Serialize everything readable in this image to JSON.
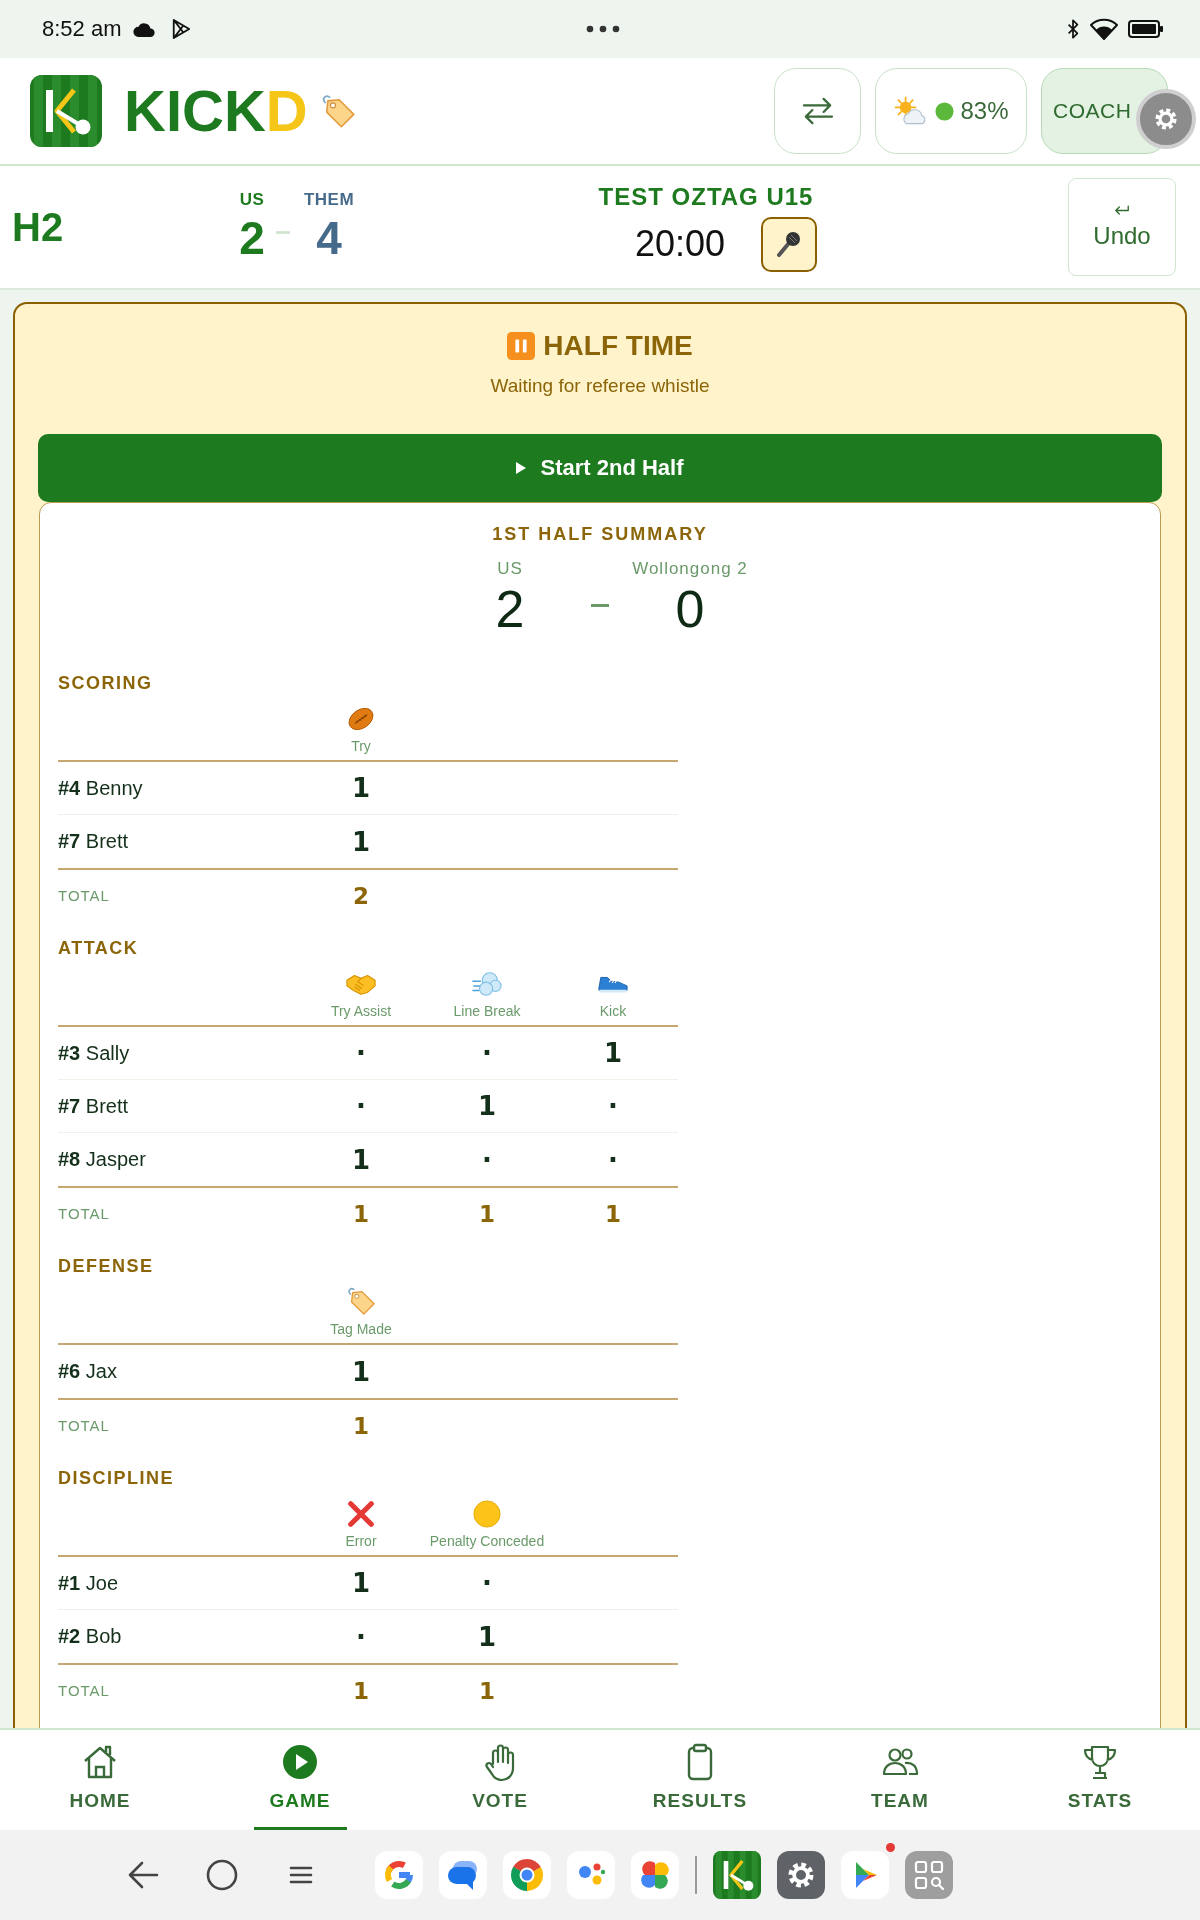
{
  "status_bar": {
    "time": "8:52 am"
  },
  "header": {
    "app_name": "KICKD",
    "weather": {
      "reading": "83%"
    },
    "coach_button": "COACH"
  },
  "score_bar": {
    "period": "H2",
    "us_label": "US",
    "them_label": "THEM",
    "us_score": "2",
    "them_score": "4",
    "match_title": "TEST OZTAG U15",
    "clock": "20:00",
    "undo_label": "Undo"
  },
  "half_time": {
    "title": "HALF TIME",
    "subtitle": "Waiting for referee whistle",
    "start_button": "Start 2nd Half"
  },
  "summary": {
    "title": "1ST HALF SUMMARY",
    "us_label": "US",
    "them_label": "Wollongong 2",
    "us_score": "2",
    "them_score": "0",
    "sections": [
      {
        "title": "SCORING",
        "columns": [
          {
            "kind": "try",
            "label": "Try"
          }
        ],
        "rows": [
          {
            "player": "**#4** Benny",
            "values": [
              "1"
            ]
          },
          {
            "player": "**#7** Brett",
            "values": [
              "1"
            ]
          }
        ],
        "total": {
          "label": "TOTAL",
          "values": [
            "2"
          ]
        }
      },
      {
        "title": "ATTACK",
        "columns": [
          {
            "kind": "assist",
            "label": "Try Assist"
          },
          {
            "kind": "break",
            "label": "Line Break"
          },
          {
            "kind": "kick",
            "label": "Kick"
          }
        ],
        "rows": [
          {
            "player": "**#3** Sally",
            "values": [
              "·",
              "·",
              "1"
            ]
          },
          {
            "player": "**#7** Brett",
            "values": [
              "·",
              "1",
              "·"
            ]
          },
          {
            "player": "**#8** Jasper",
            "values": [
              "1",
              "·",
              "·"
            ]
          }
        ],
        "total": {
          "label": "TOTAL",
          "values": [
            "1",
            "1",
            "1"
          ]
        }
      },
      {
        "title": "DEFENSE",
        "columns": [
          {
            "kind": "tag",
            "label": "Tag Made"
          }
        ],
        "rows": [
          {
            "player": "**#6** Jax",
            "values": [
              "1"
            ]
          }
        ],
        "total": {
          "label": "TOTAL",
          "values": [
            "1"
          ]
        }
      },
      {
        "title": "DISCIPLINE",
        "columns": [
          {
            "kind": "error",
            "label": "Error"
          },
          {
            "kind": "penalty",
            "label": "Penalty Conceded"
          }
        ],
        "rows": [
          {
            "player": "**#1** Joe",
            "values": [
              "1",
              "·"
            ]
          },
          {
            "player": "**#2** Bob",
            "values": [
              "·",
              "1"
            ]
          }
        ],
        "total": {
          "label": "TOTAL",
          "values": [
            "1",
            "1"
          ]
        }
      }
    ]
  },
  "nav": {
    "items": [
      {
        "label": "HOME",
        "selected": false
      },
      {
        "label": "GAME",
        "selected": true
      },
      {
        "label": "VOTE",
        "selected": false
      },
      {
        "label": "RESULTS",
        "selected": false
      },
      {
        "label": "TEAM",
        "selected": false
      },
      {
        "label": "STATS",
        "selected": false
      }
    ]
  },
  "taskbar": {
    "pinned": [
      {
        "kind": "search",
        "badge": false
      },
      {
        "kind": "messages",
        "badge": false
      },
      {
        "kind": "browser",
        "badge": false
      },
      {
        "kind": "assistant",
        "badge": false
      },
      {
        "kind": "photos",
        "badge": false
      }
    ],
    "recent": [
      {
        "kind": "kickd",
        "badge": false
      },
      {
        "kind": "settings",
        "badge": false
      },
      {
        "kind": "store",
        "badge": true
      },
      {
        "kind": "drawer",
        "badge": false
      }
    ]
  }
}
